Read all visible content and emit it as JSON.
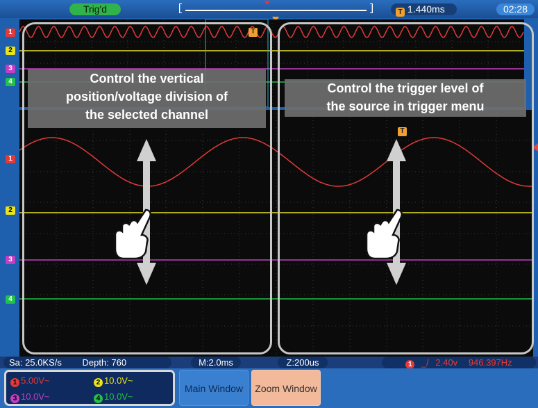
{
  "topbar": {
    "trigger_status": "Trig'd",
    "memory_left": "[",
    "memory_right": "]",
    "trigger_time": "1.440ms",
    "trigger_icon": "T",
    "clock": "02:28"
  },
  "channel_markers": {
    "ch1": "1",
    "ch2": "2",
    "ch3": "3",
    "ch4": "4",
    "trigger": "T"
  },
  "overlays": {
    "left_callout": [
      "Control the vertical",
      "position/voltage division of",
      "the selected channel"
    ],
    "right_callout": [
      "Control the trigger level of",
      "the source in trigger menu"
    ]
  },
  "status": {
    "sample_rate": "Sa: 25.0KS/s",
    "depth": "Depth: 760",
    "main_timebase": "M:2.0ms",
    "zoom_timebase": "Z:200us",
    "trigger_channel": "1",
    "trigger_slope": "_/",
    "trigger_level": "2.40v",
    "frequency": "946.397Hz"
  },
  "channels": [
    {
      "num": "1",
      "volts": "5.00V~",
      "color": "#e23a3a"
    },
    {
      "num": "2",
      "volts": "10.0V~",
      "color": "#e8e21f"
    },
    {
      "num": "3",
      "volts": "10.0V~",
      "color": "#c43fc4"
    },
    {
      "num": "4",
      "volts": "10.0V~",
      "color": "#23c04a"
    }
  ],
  "buttons": {
    "main_window": "Main Window",
    "zoom_window": "Zoom Window"
  },
  "colors": {
    "ch1": "#e23a3a",
    "ch2": "#e8e21f",
    "ch3": "#c43fc4",
    "ch4": "#23c04a",
    "trigger_marker": "#f0a030",
    "frame": "#1e5fae"
  },
  "icons": [
    "hand-pointer-icon",
    "up-down-arrow-icon",
    "trigger-position-icon",
    "clock-icon"
  ]
}
